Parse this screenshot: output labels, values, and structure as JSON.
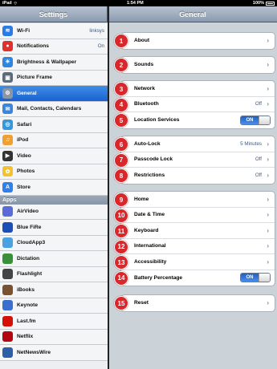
{
  "status_bar": {
    "device": "iPad",
    "time": "1:54 PM",
    "battery": "100%"
  },
  "left_nav": {
    "title": "Settings"
  },
  "right_nav": {
    "title": "General"
  },
  "sidebar": {
    "items": [
      {
        "label": "Wi-Fi",
        "value": "linksys",
        "icon": "wifi-icon",
        "color": "#2c7be5"
      },
      {
        "label": "Notifications",
        "value": "On",
        "icon": "notifications-icon",
        "color": "#e0312f"
      },
      {
        "label": "Brightness & Wallpaper",
        "value": "",
        "icon": "brightness-icon",
        "color": "#2e86de"
      },
      {
        "label": "Picture Frame",
        "value": "",
        "icon": "picture-frame-icon",
        "color": "#5b6b7a"
      },
      {
        "label": "General",
        "value": "",
        "icon": "gear-icon",
        "color": "#8a96a3"
      },
      {
        "label": "Mail, Contacts, Calendars",
        "value": "",
        "icon": "mail-icon",
        "color": "#3b86d8"
      },
      {
        "label": "Safari",
        "value": "",
        "icon": "safari-icon",
        "color": "#3498db"
      },
      {
        "label": "iPod",
        "value": "",
        "icon": "ipod-icon",
        "color": "#f0a030"
      },
      {
        "label": "Video",
        "value": "",
        "icon": "video-icon",
        "color": "#333333"
      },
      {
        "label": "Photos",
        "value": "",
        "icon": "photos-icon",
        "color": "#f1c232"
      },
      {
        "label": "Store",
        "value": "",
        "icon": "store-icon",
        "color": "#2f80ed"
      }
    ],
    "apps_header": "Apps",
    "apps": [
      {
        "label": "AirVideo",
        "icon": "airvideo-icon",
        "color": "#5a6cd8"
      },
      {
        "label": "Blue FiRe",
        "icon": "bluefire-icon",
        "color": "#1c4fb5"
      },
      {
        "label": "CloudApp3",
        "icon": "cloudapp-icon",
        "color": "#4aa3e0"
      },
      {
        "label": "Dictation",
        "icon": "dictation-icon",
        "color": "#3a8f3a"
      },
      {
        "label": "Flashlight",
        "icon": "flashlight-icon",
        "color": "#444444"
      },
      {
        "label": "iBooks",
        "icon": "ibooks-icon",
        "color": "#7a5230"
      },
      {
        "label": "Keynote",
        "icon": "keynote-icon",
        "color": "#3a6fd0"
      },
      {
        "label": "Last.fm",
        "icon": "lastfm-icon",
        "color": "#d51007"
      },
      {
        "label": "Netflix",
        "icon": "netflix-icon",
        "color": "#b20710"
      },
      {
        "label": "NetNewsWire",
        "icon": "netnewswire-icon",
        "color": "#2d5fa8"
      }
    ]
  },
  "groups": [
    {
      "rows": [
        {
          "label": "About",
          "value": "",
          "type": "chevron",
          "badge": "1"
        }
      ]
    },
    {
      "rows": [
        {
          "label": "Sounds",
          "value": "",
          "type": "chevron",
          "badge": "2"
        }
      ]
    },
    {
      "rows": [
        {
          "label": "Network",
          "value": "",
          "type": "chevron",
          "badge": "3"
        },
        {
          "label": "Bluetooth",
          "value": "Off",
          "type": "chevron",
          "badge": "4"
        },
        {
          "label": "Location Services",
          "value": "ON",
          "type": "toggle",
          "badge": "5"
        }
      ]
    },
    {
      "rows": [
        {
          "label": "Auto-Lock",
          "value": "5 Minutes",
          "type": "chevron",
          "badge": "6"
        },
        {
          "label": "Passcode Lock",
          "value": "Off",
          "type": "chevron",
          "badge": "7"
        },
        {
          "label": "Restrictions",
          "value": "Off",
          "type": "chevron",
          "badge": "8"
        }
      ]
    },
    {
      "rows": [
        {
          "label": "Home",
          "value": "",
          "type": "chevron",
          "badge": "9"
        },
        {
          "label": "Date & Time",
          "value": "",
          "type": "chevron",
          "badge": "10"
        },
        {
          "label": "Keyboard",
          "value": "",
          "type": "chevron",
          "badge": "11"
        },
        {
          "label": "International",
          "value": "",
          "type": "chevron",
          "badge": "12"
        },
        {
          "label": "Accessibility",
          "value": "",
          "type": "chevron",
          "badge": "13"
        },
        {
          "label": "Battery Percentage",
          "value": "ON",
          "type": "toggle",
          "badge": "14"
        }
      ]
    },
    {
      "rows": [
        {
          "label": "Reset",
          "value": "",
          "type": "chevron",
          "badge": "15"
        }
      ]
    }
  ]
}
